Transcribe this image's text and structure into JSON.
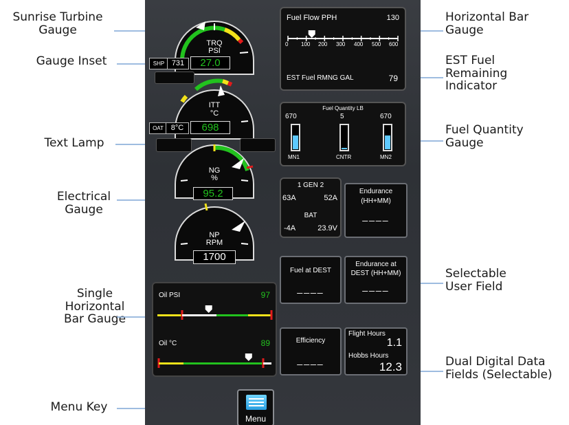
{
  "callouts": {
    "sunrise": "Sunrise Turbine Gauge",
    "inset": "Gauge Inset",
    "text_lamp": "Text Lamp",
    "electrical": "Electrical Gauge",
    "single_bar": "Single Horizontal Bar Gauge",
    "menu_key": "Menu Key",
    "horiz_bar": "Horizontal Bar Gauge",
    "est_fuel": "EST Fuel Remaining Indicator",
    "fuel_qty": "Fuel Quantity Gauge",
    "selectable": "Selectable User Field",
    "dual_digital": "Dual Digital Data Fields (Selectable)"
  },
  "gauges": {
    "trq": {
      "label1": "TRQ",
      "label2": "PSI",
      "value": "27.0"
    },
    "shp": {
      "label": "SHP",
      "value": "731"
    },
    "itt": {
      "label1": "ITT",
      "label2": "°C",
      "value": "698"
    },
    "oat": {
      "label": "OAT",
      "value": "8°C"
    },
    "ng": {
      "label1": "NG",
      "label2": "%",
      "value": "95.2"
    },
    "np": {
      "label1": "NP",
      "label2": "RPM",
      "value": "1700"
    }
  },
  "fuel_flow": {
    "label": "Fuel Flow PPH",
    "value": "130",
    "ticks": [
      "0",
      "100",
      "200",
      "300",
      "400",
      "500",
      "600"
    ],
    "fraction": 0.217
  },
  "est_fuel": {
    "label": "EST Fuel RMNG GAL",
    "value": "79"
  },
  "fuel_qty": {
    "title": "Fuel Quantity LB",
    "tanks": [
      {
        "name": "MN1",
        "value": "670",
        "level": 0.6
      },
      {
        "name": "CNTR",
        "value": "5",
        "level": 0.05
      },
      {
        "name": "MN2",
        "value": "670",
        "level": 0.6
      }
    ]
  },
  "electrical": {
    "gen_title": "1 GEN 2",
    "gen1": "63A",
    "gen2": "52A",
    "bat_title": "BAT",
    "bat_amps": "-4A",
    "bat_volts": "23.9V"
  },
  "fields": {
    "endurance": {
      "title": "Endurance (HH+MM)",
      "value": "____"
    },
    "fuel_at_dest": {
      "title": "Fuel at DEST",
      "value": "____"
    },
    "endurance_dest": {
      "title": "Endurance at DEST (HH+MM)",
      "value": "____"
    },
    "efficiency": {
      "title": "Efficiency",
      "value": "____"
    },
    "flight_hours": {
      "title": "Flight Hours",
      "value": "1.1"
    },
    "hobbs_hours": {
      "title": "Hobbs Hours",
      "value": "12.3"
    }
  },
  "oil": {
    "psi": {
      "label": "Oil PSI",
      "value": "97",
      "fraction": 0.45
    },
    "temp": {
      "label": "Oil °C",
      "value": "89",
      "fraction": 0.8
    }
  },
  "menu": {
    "label": "Menu"
  },
  "colors": {
    "green": "#22c21e",
    "yellow": "#f2e21a",
    "red": "#e01b1b",
    "cyan": "#2fd6ff",
    "panel": "#33363b"
  }
}
